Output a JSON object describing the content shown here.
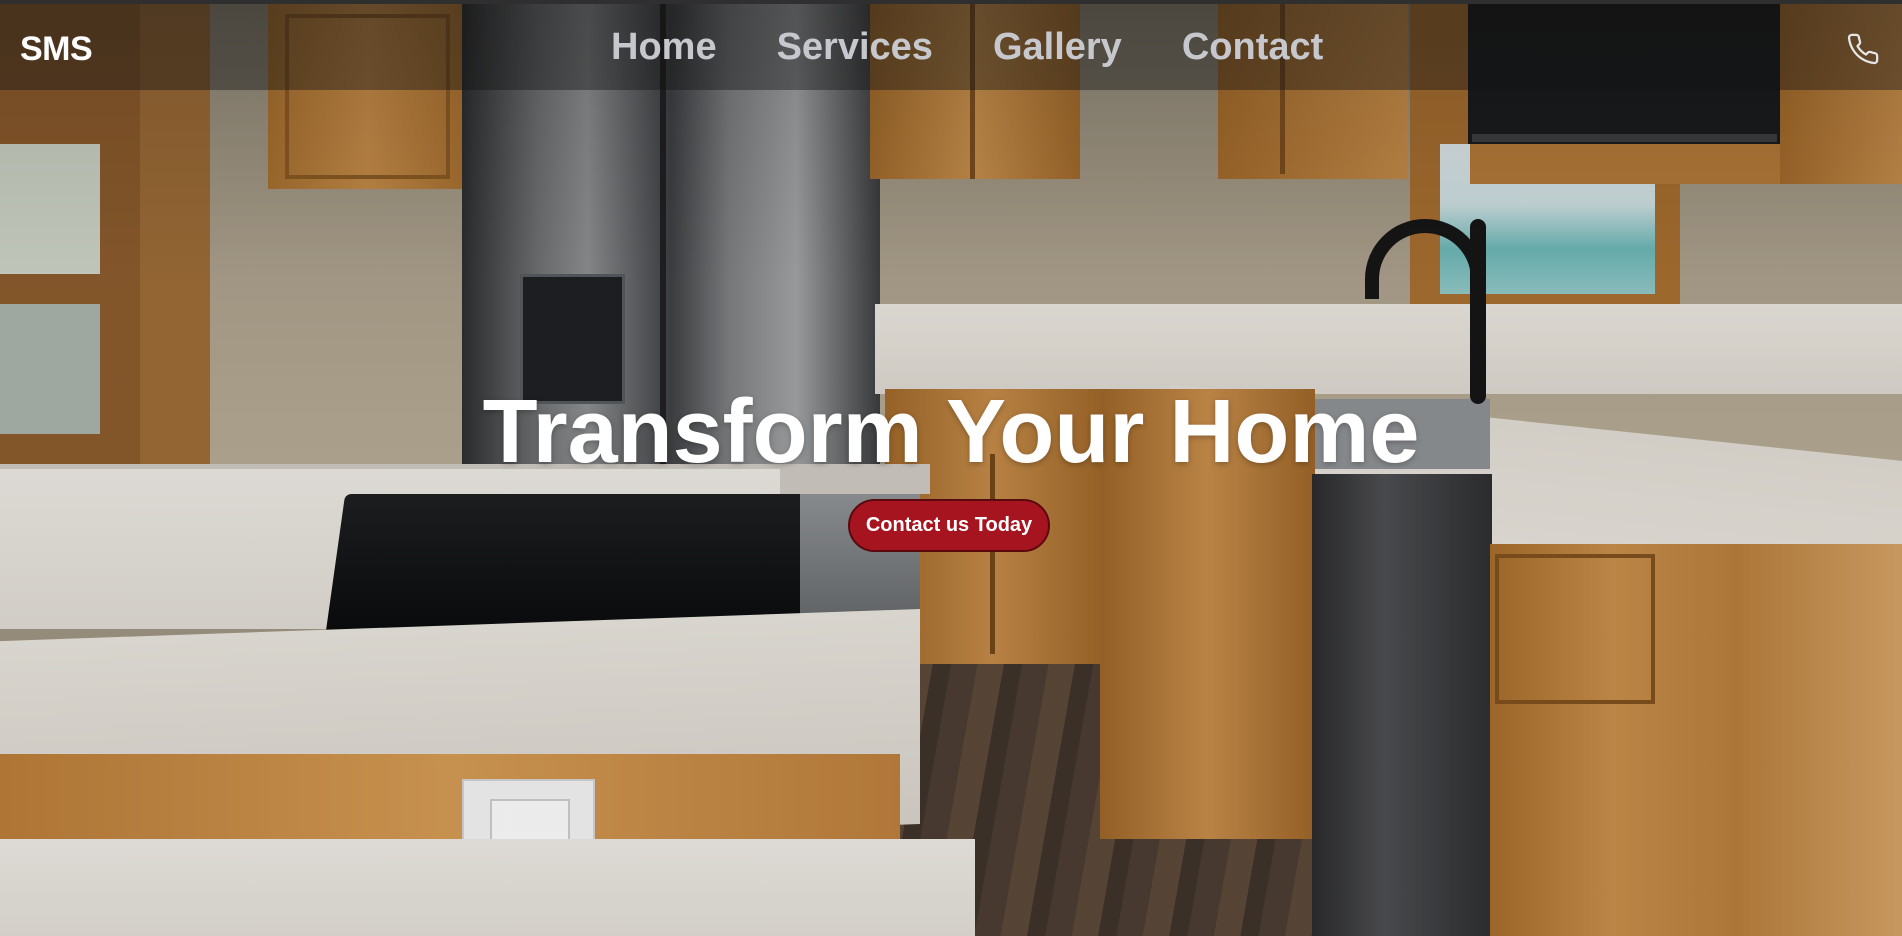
{
  "site": {
    "logo": "SMS"
  },
  "nav": {
    "items": [
      {
        "label": "Home"
      },
      {
        "label": "Services"
      },
      {
        "label": "Gallery"
      },
      {
        "label": "Contact"
      }
    ],
    "phone_icon": "phone-icon"
  },
  "hero": {
    "title": "Transform Your Home",
    "cta_label": "Contact us Today",
    "background_image": "kitchen-photo"
  },
  "colors": {
    "cta_background": "#a5141f",
    "nav_text": "#c7c8cd",
    "logo_text": "#ffffff",
    "title_text": "#ffffff"
  }
}
